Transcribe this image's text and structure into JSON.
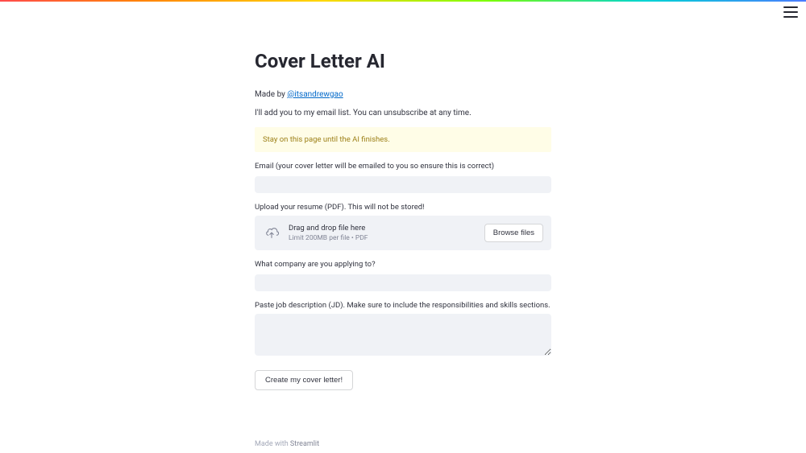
{
  "header": {
    "title": "Cover Letter AI"
  },
  "author": {
    "prefix": "Made by ",
    "handle": "@itsandrewgao"
  },
  "subline": "I'll add you to my email list. You can unsubscribe at any time.",
  "warning": "Stay on this page until the AI finishes.",
  "fields": {
    "email": {
      "label": "Email (your cover letter will be emailed to you so ensure this is correct)",
      "value": ""
    },
    "upload": {
      "label": "Upload your resume (PDF). This will not be stored!",
      "drop_text": "Drag and drop file here",
      "limit_text": "Limit 200MB per file • PDF",
      "browse_label": "Browse files"
    },
    "company": {
      "label": "What company are you applying to?",
      "value": ""
    },
    "jd": {
      "label": "Paste job description (JD). Make sure to include the responsibilities and skills sections.",
      "value": ""
    }
  },
  "submit_label": "Create my cover letter!",
  "footer": {
    "prefix": "Made with ",
    "brand": "Streamlit"
  }
}
